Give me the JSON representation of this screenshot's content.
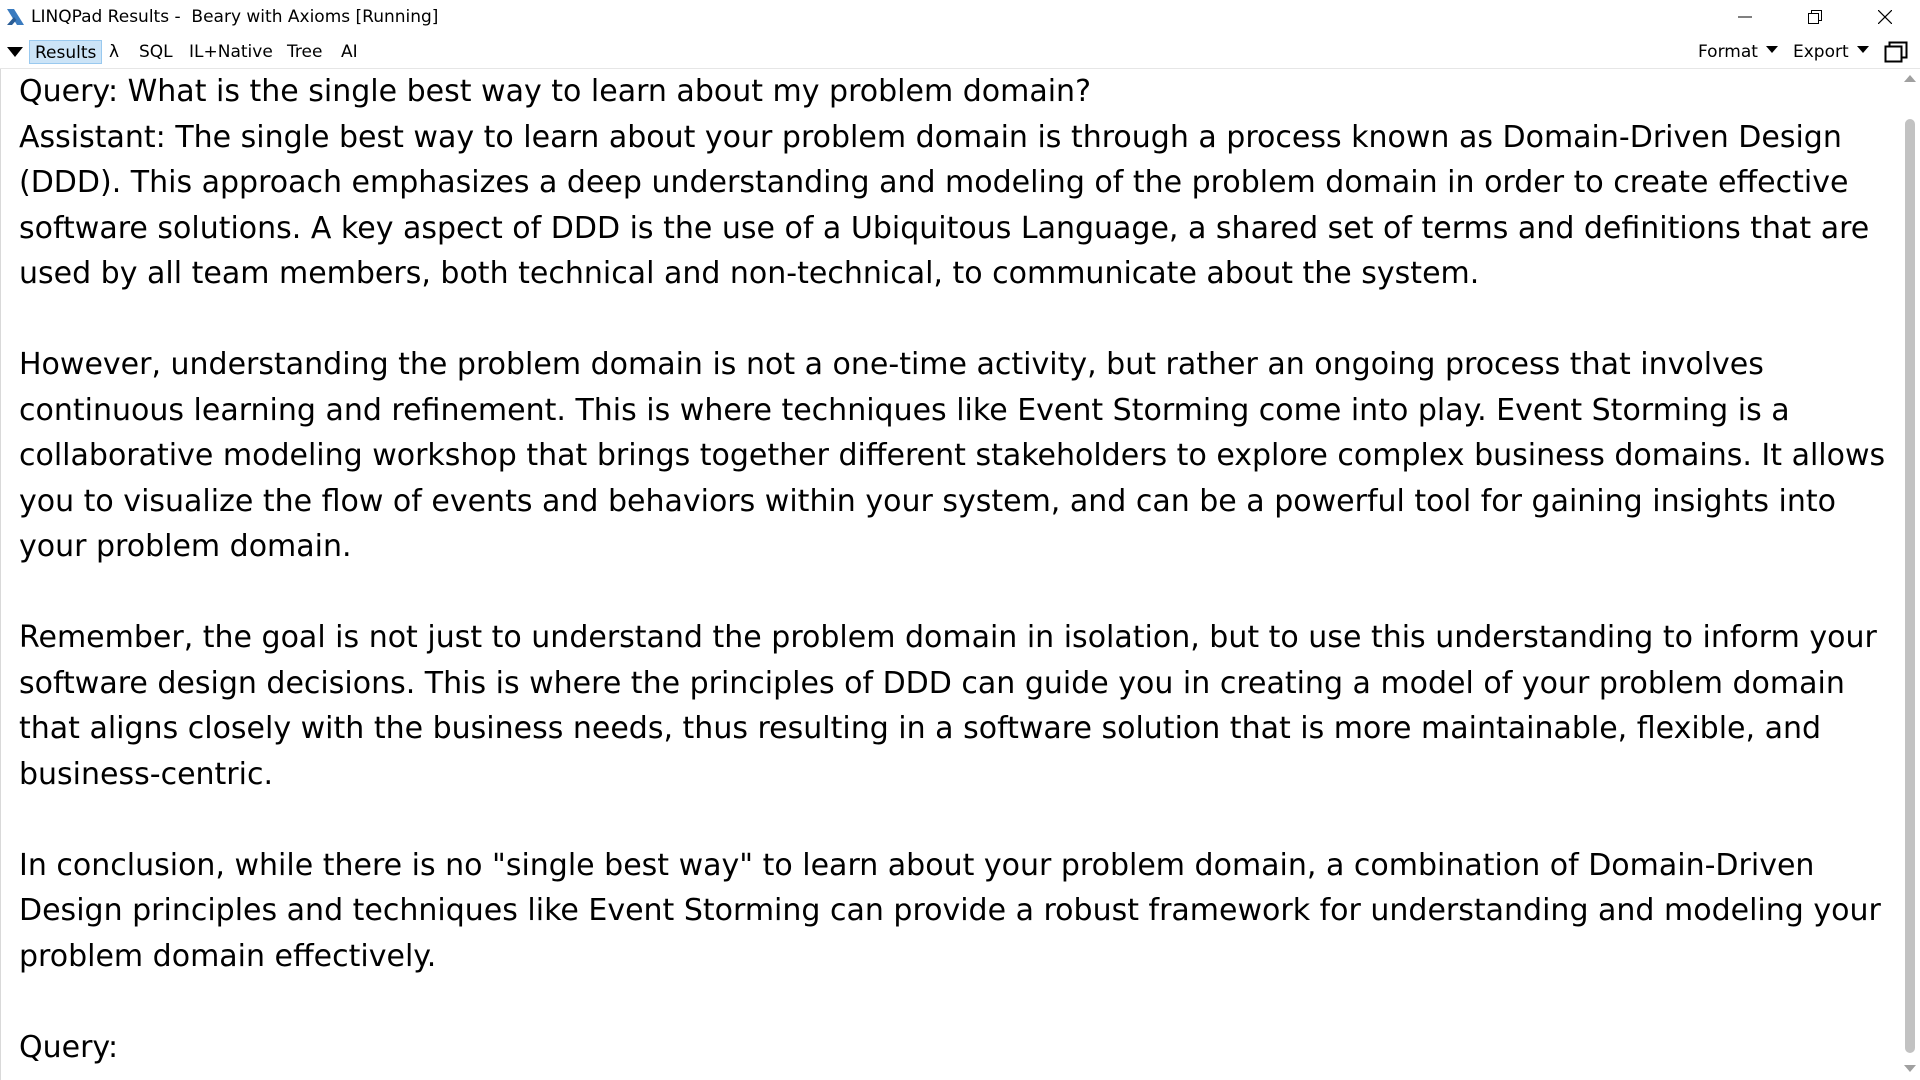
{
  "window": {
    "title": "LINQPad Results -  Beary with Axioms [Running]"
  },
  "toolbar": {
    "tabs": [
      {
        "label": "Results",
        "active": true
      },
      {
        "label": "λ"
      },
      {
        "label": "SQL"
      },
      {
        "label": "IL+Native"
      },
      {
        "label": "Tree"
      },
      {
        "label": "AI"
      }
    ],
    "format_label": "Format",
    "export_label": "Export"
  },
  "results": {
    "text": "Query: What is the single best way to learn about my problem domain?\nAssistant: The single best way to learn about your problem domain is through a process known as Domain-Driven Design (DDD). This approach emphasizes a deep understanding and modeling of the problem domain in order to create effective software solutions. A key aspect of DDD is the use of a Ubiquitous Language, a shared set of terms and definitions that are used by all team members, both technical and non-technical, to communicate about the system.\n\nHowever, understanding the problem domain is not a one-time activity, but rather an ongoing process that involves continuous learning and refinement. This is where techniques like Event Storming come into play. Event Storming is a collaborative modeling workshop that brings together different stakeholders to explore complex business domains. It allows you to visualize the flow of events and behaviors within your system, and can be a powerful tool for gaining insights into your problem domain.\n\nRemember, the goal is not just to understand the problem domain in isolation, but to use this understanding to inform your software design decisions. This is where the principles of DDD can guide you in creating a model of your problem domain that aligns closely with the business needs, thus resulting in a software solution that is more maintainable, flexible, and business-centric.\n\nIn conclusion, while there is no \"single best way\" to learn about your problem domain, a combination of Domain-Driven Design principles and techniques like Event Storming can provide a robust framework for understanding and modeling your problem domain effectively.\n\nQuery: "
  },
  "colors": {
    "active_tab_bg": "#cce4f7",
    "active_tab_border": "#99c9ef",
    "scroll_thumb": "#c2c2c2"
  },
  "icons": [
    "linqpad-app-icon",
    "minimize-icon",
    "restore-icon",
    "close-icon",
    "dropdown-arrow-icon",
    "popout-icon",
    "scroll-up-icon",
    "scroll-down-icon"
  ]
}
